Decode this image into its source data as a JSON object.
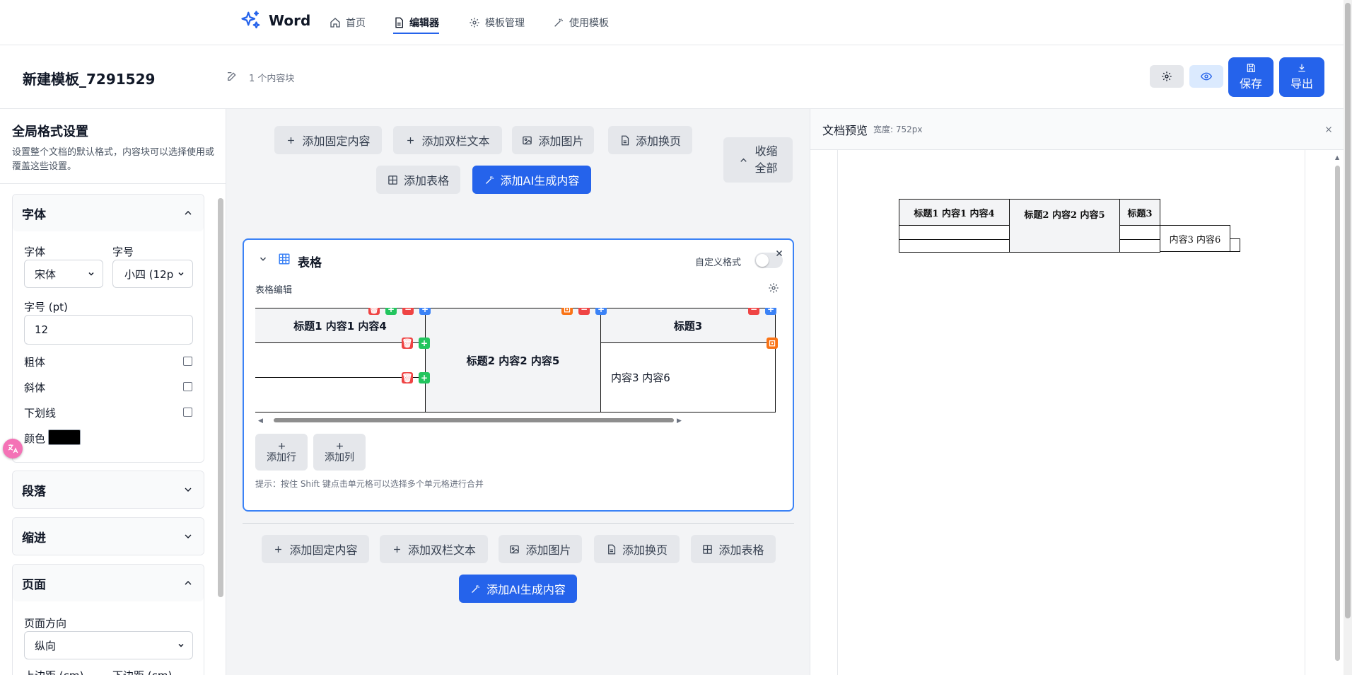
{
  "nav": {
    "brand": "Word",
    "links": [
      {
        "label": "首页"
      },
      {
        "label": "编辑器"
      },
      {
        "label": "模板管理"
      },
      {
        "label": "使用模板"
      }
    ]
  },
  "header": {
    "title": "新建模板_7291529",
    "block_count": "1 个内容块",
    "save_label": "保存",
    "export_label": "导出"
  },
  "sidebar": {
    "title": "全局格式设置",
    "description": "设置整个文档的默认格式，内容块可以选择使用或覆盖这些设置。",
    "font_section": {
      "title": "字体",
      "font_label": "字体",
      "font_value": "宋体",
      "size_label": "字号",
      "size_value": "小四 (12p",
      "size_pt_label": "字号 (pt)",
      "size_pt_value": "12",
      "bold_label": "粗体",
      "italic_label": "斜体",
      "underline_label": "下划线",
      "color_label": "颜色",
      "color_value": "#000000"
    },
    "paragraph_title": "段落",
    "indent_title": "缩进",
    "page_section": {
      "title": "页面",
      "orientation_label": "页面方向",
      "orientation_value": "纵向",
      "top_margin_label": "上边距 (cm)",
      "bottom_margin_label": "下边距 (cm)"
    }
  },
  "editor": {
    "top_buttons": {
      "add_fixed": "添加固定内容",
      "add_two_col": "添加双栏文本",
      "add_image": "添加图片",
      "add_page_break": "添加换页",
      "add_table": "添加表格",
      "add_ai": "添加AI生成内容"
    },
    "collapse_label_1": "收缩",
    "collapse_label_2": "全部",
    "card": {
      "title": "表格",
      "custom_format_label": "自定义格式",
      "table_edit_label": "表格编辑",
      "cells": {
        "h1": "标题1 内容1 内容4",
        "h2": "标题2 内容2 内容5",
        "h3": "标题3",
        "c3": "内容3 内容6"
      },
      "add_row_label": "添加行",
      "add_col_label": "添加列",
      "hint": "提示：按住 Shift 键点击单元格可以选择多个单元格进行合并"
    },
    "bottom_buttons": {
      "add_fixed": "添加固定内容",
      "add_two_col": "添加双栏文本",
      "add_image": "添加图片",
      "add_page_break": "添加换页",
      "add_table": "添加表格",
      "add_ai": "添加AI生成内容"
    }
  },
  "preview": {
    "title": "文档预览",
    "width_label": "宽度: 752px",
    "cells": {
      "h1": "标题1  内容1  内容4",
      "h2": "标题2  内容2  内容5",
      "h3": "标题3",
      "c3": "内容3  内容6"
    }
  },
  "colors": {
    "accent": "#2563eb",
    "panel_bg": "#f3f4f6"
  }
}
